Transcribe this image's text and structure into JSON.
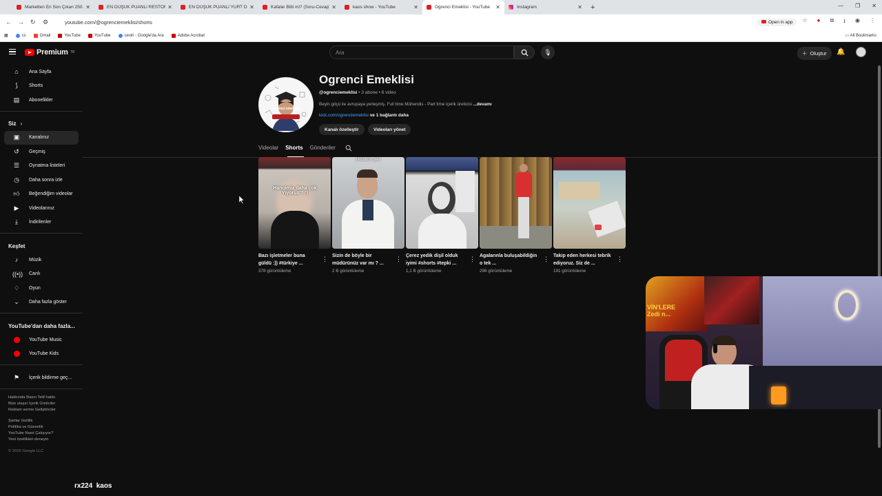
{
  "browser": {
    "tabs": [
      {
        "title": "Marketten En Son Çıkan 250.00",
        "icon": "youtube-icon"
      },
      {
        "title": "EN DÜŞÜK PUANLI RESTORAN",
        "icon": "youtube-icon"
      },
      {
        "title": "EN DÜŞÜK PUANLI YURT DIŞI",
        "icon": "youtube-icon"
      },
      {
        "title": "Kafalar Bitti mi? (Soru-Cevap)",
        "icon": "youtube-icon"
      },
      {
        "title": "kaos show - YouTube",
        "icon": "youtube-icon"
      },
      {
        "title": "Ogrenci Emeklisi - YouTube",
        "icon": "youtube-icon"
      },
      {
        "title": "Instagram",
        "icon": "instagram-icon"
      }
    ],
    "url": "youtube.com/@ogrenciemeklisi/shorts",
    "open_in_app": "Open in app",
    "bookmarks": [
      "cs",
      "Gmail",
      "YouTube",
      "YouTube",
      "ceviri - Google'da Ara",
      "Adobe Acrobat"
    ],
    "all_bookmarks": "All Bookmarks"
  },
  "header": {
    "logo_text": "Premium",
    "logo_sup": "TR",
    "search_placeholder": "Ara",
    "create_label": "Oluştur"
  },
  "sidebar": {
    "main": [
      "Ana Sayfa",
      "Shorts",
      "Abonelikler"
    ],
    "you_heading": "Siz",
    "you_items": [
      "Kanalınız",
      "Geçmiş",
      "Oynatma listeleri",
      "Daha sonra izle",
      "Beğendiğim videolar",
      "Videolarınız",
      "İndirilenler"
    ],
    "explore_heading": "Keşfet",
    "explore_items": [
      "Müzik",
      "Canlı",
      "Oyun",
      "Daha fazla göster"
    ],
    "more_heading": "YouTube'dan daha fazla...",
    "more_items": [
      "YouTube Music",
      "YouTube Kids"
    ],
    "report": "İçerik bildirme geç...",
    "footer1": "Hakkında  Basın  Telif hakkı",
    "footer2": "Bize ulaşın  İçerik Üreticiler",
    "footer3": "Reklam verme  Geliştiriciler",
    "footer4": "Şartlar  Gizlilik",
    "footer5": "Politika ve Güvenlik",
    "footer6": "YouTube Nasıl Çalışıyor?",
    "footer7": "Yeni özellikleri deneyin",
    "copyright": "© 2025 Google LLC"
  },
  "channel": {
    "name": "Ogrenci Emeklisi",
    "handle": "@ogrenciemeklisi",
    "stats": " • 3 abone • 6 video",
    "description": "Beyin göçü ile avrupaya yerleşmiş. Full time Mühendis - Part time içerik üreticisi ",
    "more": "...devamı",
    "link": "kick.com/ogrenciemeklisi",
    "link_more": " ve 1 bağlantı daha",
    "customize_button": "Kanalı özelleştir",
    "manage_button": "Videoları yönet",
    "avatar_text": "ogrenci emeklisi",
    "tabs": [
      "Videolar",
      "Shorts",
      "Gönderiler"
    ]
  },
  "shorts": [
    {
      "title": "Bazı işletmeler buna güldü :)) #türkiye ...",
      "views": "378 görüntüleme",
      "overlay": "Hangimiz daha çok Yiyoruz ? :)"
    },
    {
      "title": "Sizin de böyle bir müdürünüz var mı ? ...",
      "views": "2 B görüntüleme",
      "overlay": "Müdürün gelir"
    },
    {
      "title": "Çerez yedik dişil olduk iyimi #shorts #tepki ...",
      "views": "1,1 B görüntüleme",
      "overlay": ""
    },
    {
      "title": "Agalarınla buluşabildiğin o tek ...",
      "views": "298 görüntüleme",
      "overlay": ""
    },
    {
      "title": "Takip eden herkesi tebrik ediyoruz. Siz de ...",
      "views": "191 görüntüleme",
      "overlay": ""
    }
  ],
  "stream": {
    "caption_user": "rx224",
    "caption_text": "kaos",
    "poster_text": "VİN'LERE Zedi n..."
  }
}
